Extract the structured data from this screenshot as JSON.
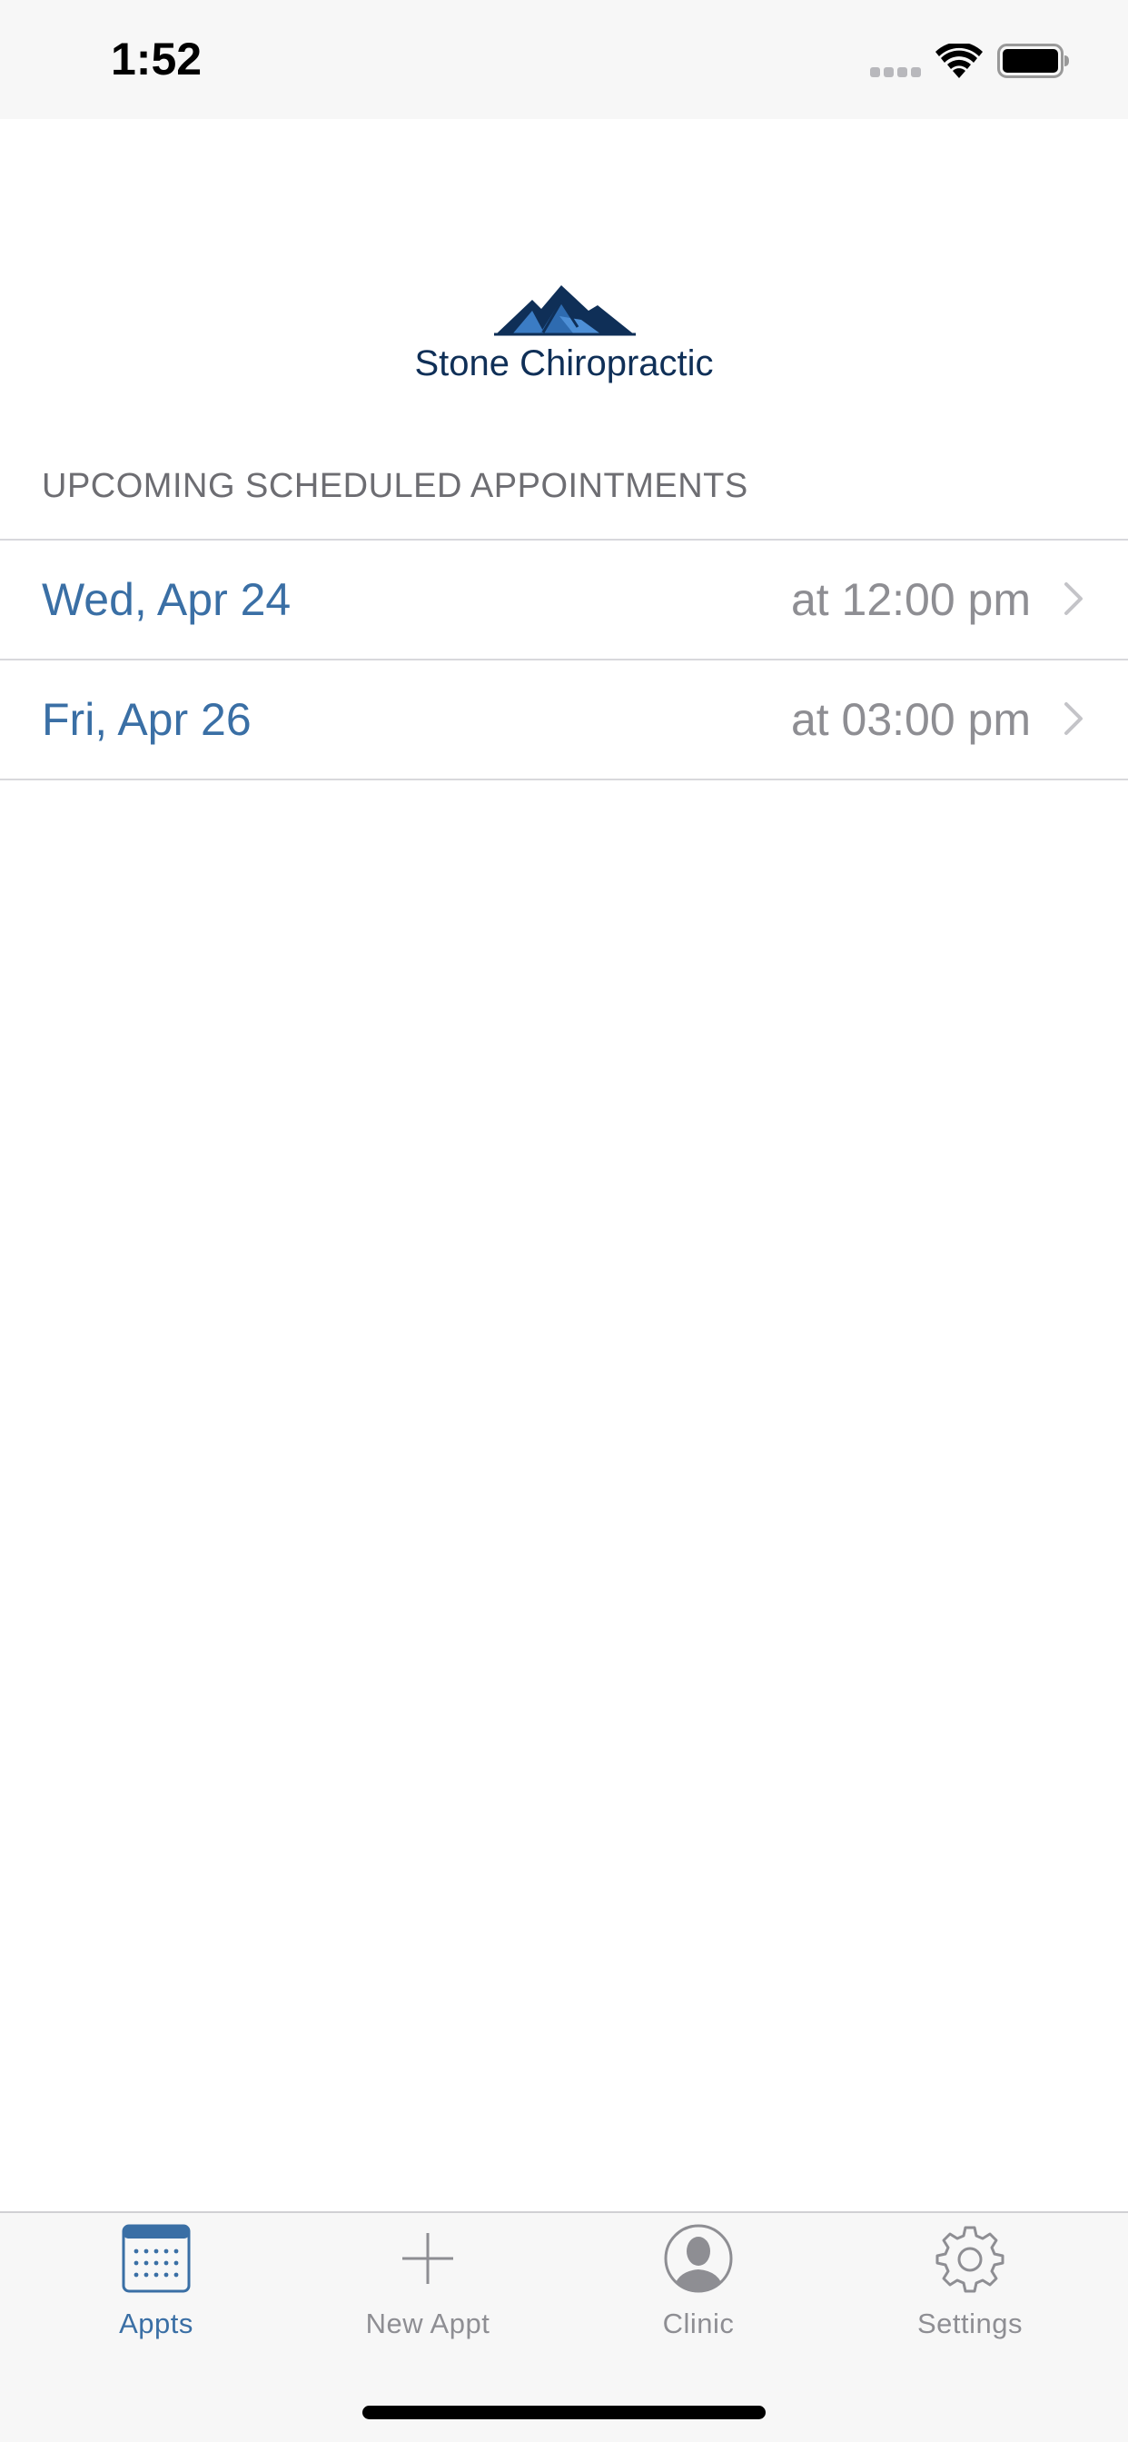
{
  "status_bar": {
    "time": "1:52",
    "icons": [
      "signal-icon",
      "wifi-icon",
      "battery-icon"
    ]
  },
  "clinic": {
    "name": "Stone Chiropractic",
    "logo_icon": "mountains-logo",
    "brand_color": "#0f2f57"
  },
  "appointments": {
    "section_title": "UPCOMING SCHEDULED APPOINTMENTS",
    "items": [
      {
        "date": "Wed, Apr 24",
        "time": "at 12:00 pm"
      },
      {
        "date": "Fri, Apr 26",
        "time": "at 03:00 pm"
      }
    ]
  },
  "tab_bar": {
    "active_color": "#3a6fa5",
    "inactive_color": "#8e8e93",
    "tabs": [
      {
        "label": "Appts",
        "icon": "calendar-icon",
        "active": true
      },
      {
        "label": "New Appt",
        "icon": "plus-icon",
        "active": false
      },
      {
        "label": "Clinic",
        "icon": "person-icon",
        "active": false
      },
      {
        "label": "Settings",
        "icon": "gear-icon",
        "active": false
      }
    ]
  }
}
